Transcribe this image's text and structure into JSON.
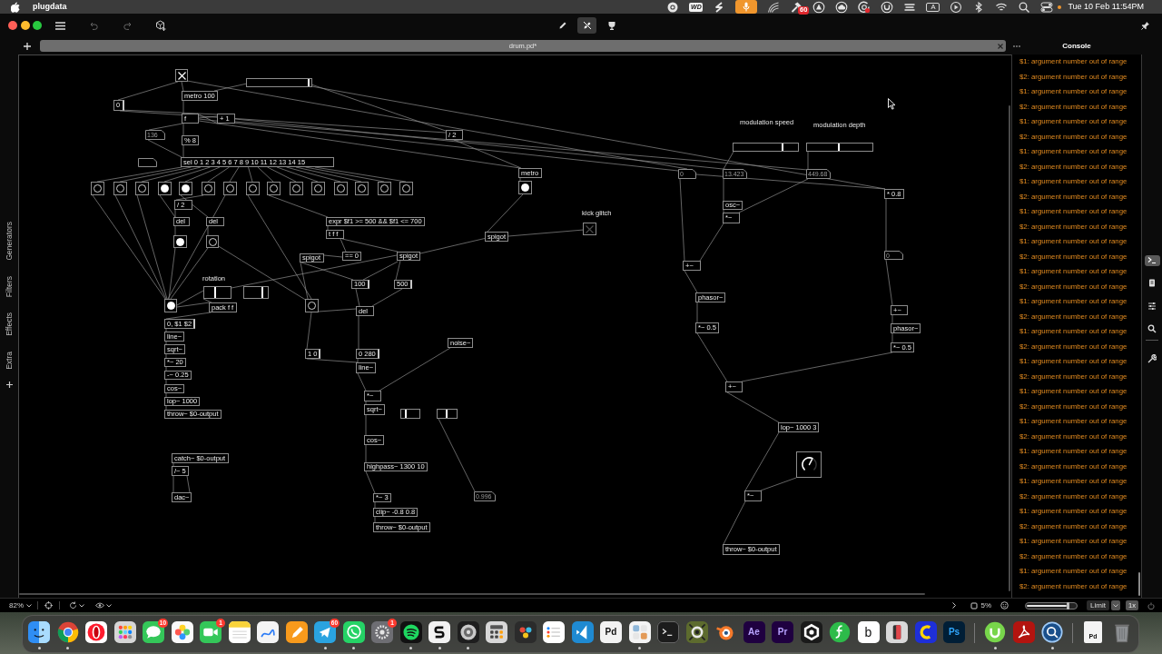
{
  "menu_bar": {
    "app_name": "plugdata",
    "drive_label": "WD",
    "badge": "60",
    "input_source": "A",
    "clock": "Tue 10 Feb 11:54PM"
  },
  "toolbar": {
    "modes": [
      {
        "selected": false
      },
      {
        "selected": true
      },
      {
        "selected": false
      }
    ]
  },
  "tabs": [
    {
      "title": "drum.pd*"
    }
  ],
  "sidebar": {
    "categories": [
      "Generators",
      "Filters",
      "Effects",
      "Extra"
    ]
  },
  "canvas": {
    "nodes": [
      {
        "kind": "toggle",
        "checked": true
      },
      {
        "kind": "slider",
        "level": 0.97
      },
      {
        "kind": "object",
        "text": "metro 100"
      },
      {
        "kind": "message",
        "text": "0"
      },
      {
        "kind": "object",
        "text": "f"
      },
      {
        "kind": "object",
        "text": "+ 1"
      },
      {
        "kind": "comment",
        "text": "modulation speed"
      },
      {
        "kind": "comment",
        "text": "modulation depth"
      },
      {
        "kind": "number",
        "text": "136"
      },
      {
        "kind": "object",
        "text": "% 8"
      },
      {
        "kind": "object",
        "text": "/ 2"
      },
      {
        "kind": "slider",
        "level": 0.77
      },
      {
        "kind": "slider",
        "level": 0.48
      },
      {
        "kind": "number"
      },
      {
        "kind": "object",
        "text": "sel 0 1 2 3 4 5 6 7 8 9 10 11 12 13 14 15"
      },
      {
        "kind": "object",
        "text": "metro"
      },
      {
        "kind": "number",
        "text": "0"
      },
      {
        "kind": "number",
        "text": "13.423"
      },
      {
        "kind": "number",
        "text": "449.68"
      },
      {
        "kind": "bang",
        "active": false
      },
      {
        "kind": "bang",
        "active": false
      },
      {
        "kind": "bang",
        "active": false
      },
      {
        "kind": "bang",
        "active": true
      },
      {
        "kind": "bang",
        "active": true
      },
      {
        "kind": "bang",
        "active": false
      },
      {
        "kind": "bang",
        "active": false
      },
      {
        "kind": "bang",
        "active": false
      },
      {
        "kind": "bang",
        "active": false
      },
      {
        "kind": "bang",
        "active": false
      },
      {
        "kind": "bang",
        "active": false
      },
      {
        "kind": "bang",
        "active": false
      },
      {
        "kind": "bang",
        "active": false
      },
      {
        "kind": "bang",
        "active": false
      },
      {
        "kind": "bang",
        "active": false
      },
      {
        "kind": "bang",
        "active": true
      },
      {
        "kind": "object",
        "text": "* 0.8"
      },
      {
        "kind": "object",
        "text": "/ 2"
      },
      {
        "kind": "object",
        "text": "osc~"
      },
      {
        "kind": "object",
        "text": "del"
      },
      {
        "kind": "object",
        "text": "del"
      },
      {
        "kind": "object",
        "text": "expr $f1 >= 500 && $f1 <= 700"
      },
      {
        "kind": "comment",
        "text": "kick glitch"
      },
      {
        "kind": "object",
        "text": "*~"
      },
      {
        "kind": "bang",
        "active": true
      },
      {
        "kind": "bang",
        "active": false
      },
      {
        "kind": "object",
        "text": "t f f"
      },
      {
        "kind": "object",
        "text": "spigot"
      },
      {
        "kind": "toggle",
        "checked": false
      },
      {
        "kind": "object",
        "text": "spigot"
      },
      {
        "kind": "object",
        "text": "== 0"
      },
      {
        "kind": "object",
        "text": "spigot"
      },
      {
        "kind": "number",
        "text": "0"
      },
      {
        "kind": "object",
        "text": "+~"
      },
      {
        "kind": "comment",
        "text": "rotation"
      },
      {
        "kind": "slider",
        "level": 0.4
      },
      {
        "kind": "slider",
        "level": 0.78
      },
      {
        "kind": "message",
        "text": "100"
      },
      {
        "kind": "message",
        "text": "500"
      },
      {
        "kind": "bang",
        "active": true
      },
      {
        "kind": "object",
        "text": "pack f f"
      },
      {
        "kind": "bang",
        "active": false
      },
      {
        "kind": "object",
        "text": "del"
      },
      {
        "kind": "object",
        "text": "phasor~"
      },
      {
        "kind": "object",
        "text": "+~"
      },
      {
        "kind": "message",
        "text": "0, $1 $2"
      },
      {
        "kind": "object",
        "text": "line~"
      },
      {
        "kind": "object",
        "text": "*~ 0.5"
      },
      {
        "kind": "object",
        "text": "phasor~"
      },
      {
        "kind": "object",
        "text": "sqrt~"
      },
      {
        "kind": "message",
        "text": "1 0"
      },
      {
        "kind": "message",
        "text": "0 280"
      },
      {
        "kind": "object",
        "text": "noise~"
      },
      {
        "kind": "object",
        "text": "*~ 0.5"
      },
      {
        "kind": "object",
        "text": "*~ 20"
      },
      {
        "kind": "object",
        "text": "-~ 0.25"
      },
      {
        "kind": "object",
        "text": "line~"
      },
      {
        "kind": "object",
        "text": "cos~"
      },
      {
        "kind": "object",
        "text": "lop~ 1000"
      },
      {
        "kind": "object",
        "text": "throw~ $0-output"
      },
      {
        "kind": "object",
        "text": "*~"
      },
      {
        "kind": "object",
        "text": "sqrt~"
      },
      {
        "kind": "slider",
        "level": 0.23
      },
      {
        "kind": "slider",
        "level": 0.48
      },
      {
        "kind": "object",
        "text": "+~"
      },
      {
        "kind": "object",
        "text": "lop~ 1000 3"
      },
      {
        "kind": "object",
        "text": "cos~"
      },
      {
        "kind": "object",
        "text": "catch~ $0-output"
      },
      {
        "kind": "object",
        "text": "/~ 5"
      },
      {
        "kind": "object",
        "text": "highpass~ 1300 10"
      },
      {
        "kind": "knob",
        "level": 0.6
      },
      {
        "kind": "object",
        "text": "dac~"
      },
      {
        "kind": "object",
        "text": "*~ 3"
      },
      {
        "kind": "number",
        "text": "0.996"
      },
      {
        "kind": "object",
        "text": "*~"
      },
      {
        "kind": "object",
        "text": "clip~ -0.8 0.8"
      },
      {
        "kind": "object",
        "text": "throw~ $0-output"
      },
      {
        "kind": "object",
        "text": "throw~ $0-output"
      }
    ]
  },
  "console": {
    "title": "Console",
    "messages": [
      "$1: argument number out of range",
      "$2: argument number out of range",
      "$1: argument number out of range",
      "$2: argument number out of range",
      "$1: argument number out of range",
      "$2: argument number out of range",
      "$1: argument number out of range",
      "$2: argument number out of range",
      "$1: argument number out of range",
      "$2: argument number out of range",
      "$1: argument number out of range",
      "$2: argument number out of range",
      "$1: argument number out of range",
      "$2: argument number out of range",
      "$1: argument number out of range",
      "$2: argument number out of range",
      "$1: argument number out of range",
      "$2: argument number out of range",
      "$1: argument number out of range",
      "$2: argument number out of range",
      "$1: argument number out of range",
      "$2: argument number out of range",
      "$1: argument number out of range",
      "$2: argument number out of range",
      "$1: argument number out of range",
      "$2: argument number out of range",
      "$1: argument number out of range",
      "$2: argument number out of range",
      "$1: argument number out of range",
      "$2: argument number out of range",
      "$1: argument number out of range",
      "$2: argument number out of range",
      "$1: argument number out of range",
      "$2: argument number out of range",
      "$1: argument number out of range",
      "$2: argument number out of range"
    ]
  },
  "side_panel": {
    "tools": [
      {
        "selected": true
      },
      {
        "selected": false
      },
      {
        "selected": false
      },
      {
        "selected": false
      },
      {
        "selected": false
      }
    ]
  },
  "status_bar": {
    "zoom": "82%",
    "cpu": "5%",
    "volume": {
      "level": 0.85
    },
    "limit": "Limit",
    "oversampling": "1x"
  },
  "dock": {
    "apps": [
      {
        "running": true
      },
      {
        "running": true
      },
      {
        "running": false
      },
      {
        "running": false
      },
      {
        "running": false,
        "badge": "10"
      },
      {
        "running": false
      },
      {
        "running": false,
        "badge": "1"
      },
      {
        "running": false
      },
      {
        "running": false
      },
      {
        "running": false
      },
      {
        "running": true,
        "badge": "60"
      },
      {
        "running": true
      },
      {
        "running": false,
        "badge": "1"
      },
      {
        "running": true
      },
      {
        "running": true
      },
      {
        "running": true
      },
      {
        "running": false
      },
      {
        "running": false
      },
      {
        "running": false
      },
      {
        "running": false
      },
      {
        "label": "Pd",
        "running": false
      },
      {
        "running": true
      },
      {
        "running": false
      },
      {
        "running": false
      },
      {
        "running": false
      },
      {
        "label": "Ae",
        "running": false
      },
      {
        "label": "Pr",
        "running": false
      },
      {
        "running": false
      },
      {
        "running": false
      },
      {
        "label": "b",
        "running": false
      },
      {
        "running": false
      },
      {
        "running": false
      },
      {
        "label": "Ps",
        "running": false
      },
      {
        "running": true
      },
      {
        "running": false
      },
      {
        "running": true
      },
      {
        "label": "Pd",
        "running": false
      },
      {
        "running": false
      }
    ]
  }
}
